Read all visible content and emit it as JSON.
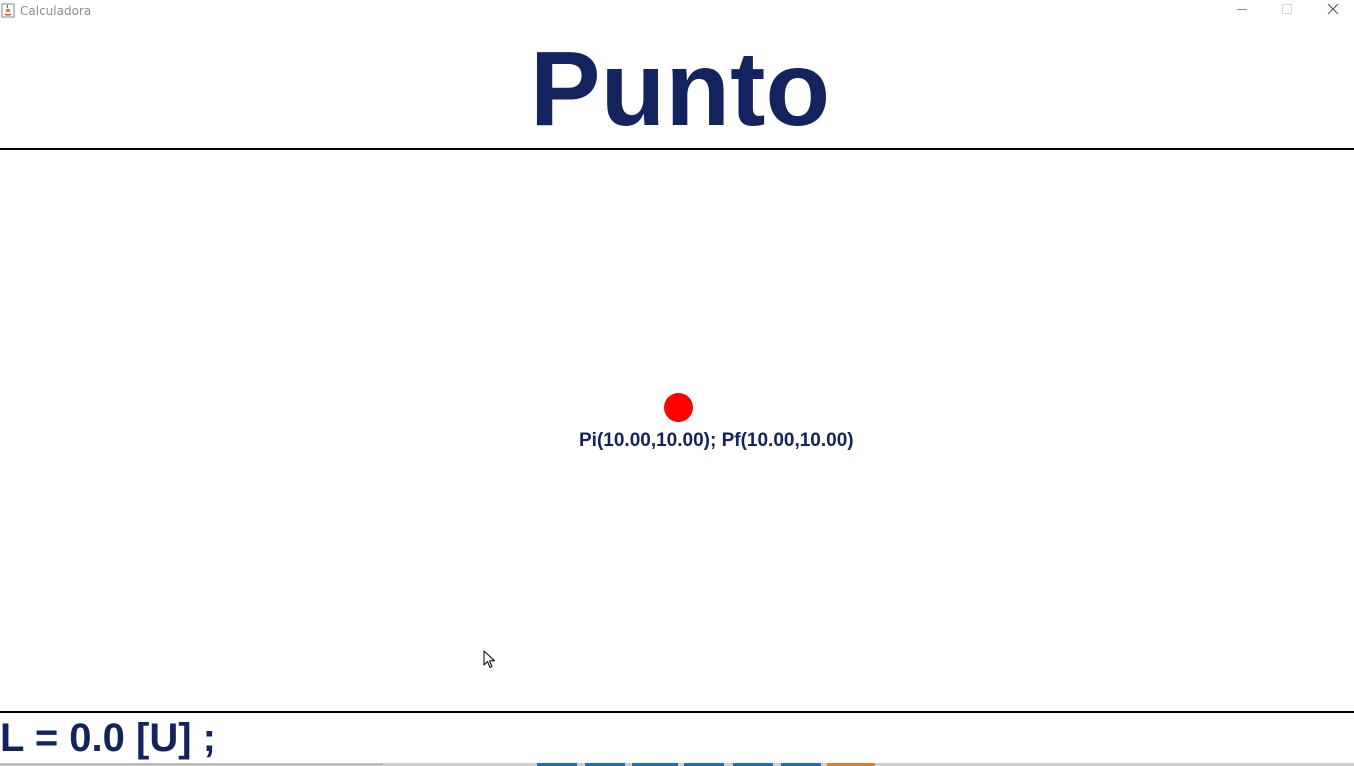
{
  "window": {
    "title": "Calculadora",
    "icon": "java-coffee-icon",
    "controls": [
      "minimize-icon",
      "maximize-icon",
      "close-icon"
    ]
  },
  "header": {
    "title": "Punto"
  },
  "canvas": {
    "point_label": "Pi(10.00,10.00); Pf(10.00,10.00)",
    "point_color": "#ff0000"
  },
  "footer": {
    "length_readout": "L = 0.0 [U] ;"
  },
  "colors": {
    "text_navy": "#13235e",
    "divider": "#000000",
    "point": "#ff0000",
    "background": "#ffffff"
  }
}
